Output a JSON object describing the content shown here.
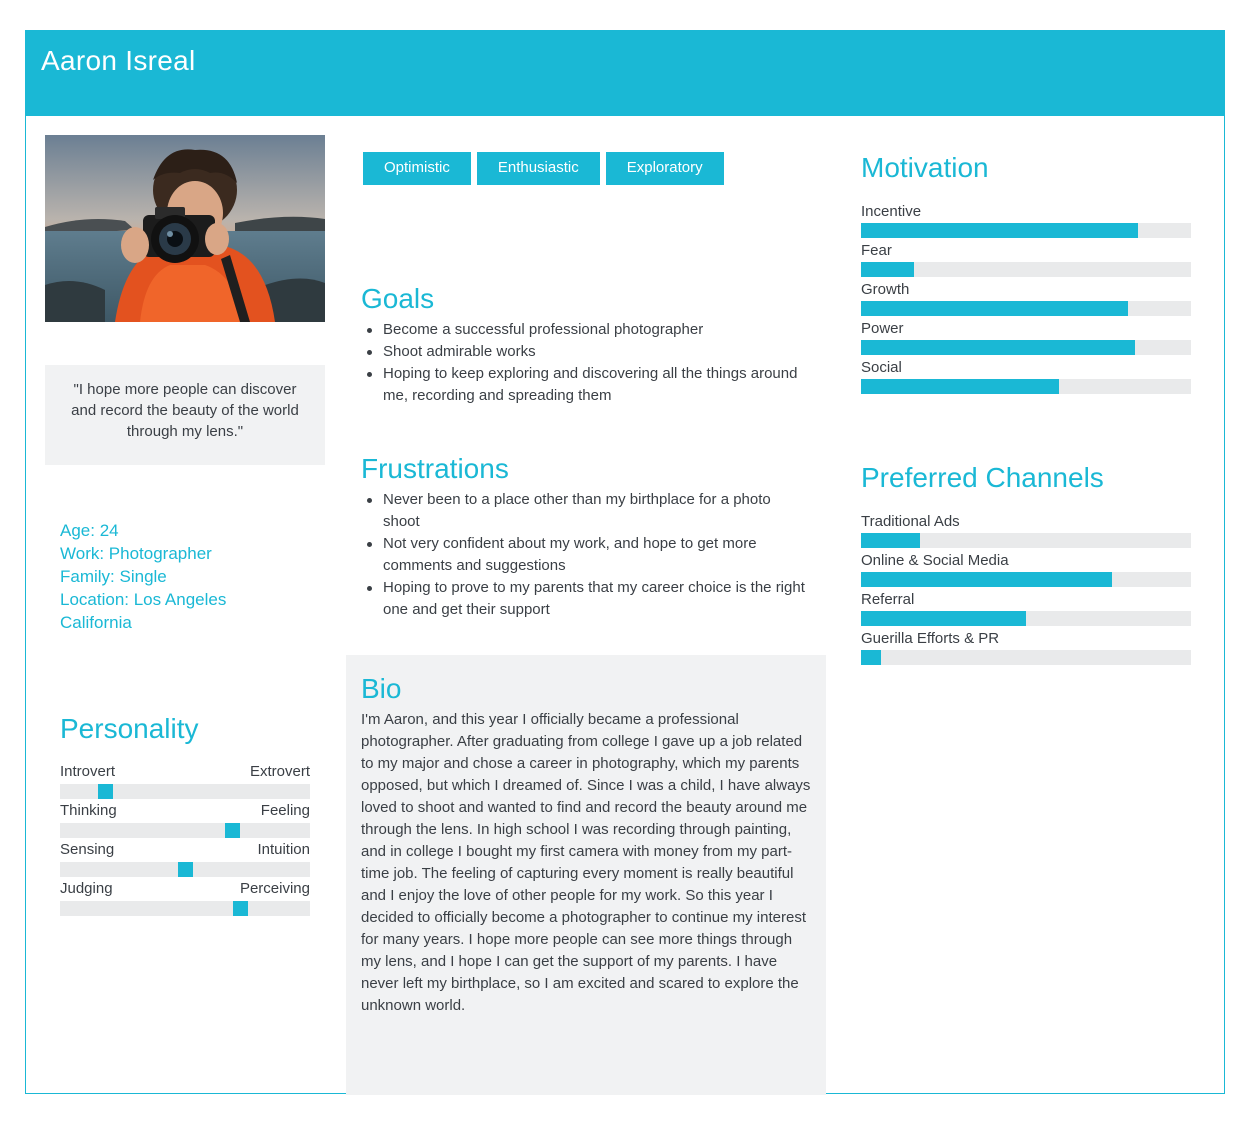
{
  "header": {
    "name": "Aaron Isreal"
  },
  "photo": {
    "description_icon": "photographer-portrait"
  },
  "quote": "\"I hope more people can discover and record the beauty of the world through my lens.\"",
  "demographics": {
    "age": "Age: 24",
    "work": "Work: Photographer",
    "family": "Family: Single",
    "location": "Location: Los Angeles⁣",
    "location_cont": "California"
  },
  "personality": {
    "title": "Personality",
    "traits": [
      {
        "left": "Introvert",
        "right": "Extrovert",
        "value": 0.18
      },
      {
        "left": "Thinking",
        "right": "Feeling",
        "value": 0.69
      },
      {
        "left": "Sensing",
        "right": "Intuition",
        "value": 0.5
      },
      {
        "left": "Judging",
        "right": "Perceiving",
        "value": 0.72
      }
    ]
  },
  "tags": [
    "Optimistic",
    "Enthusiastic",
    "Exploratory"
  ],
  "goals": {
    "title": "Goals",
    "items": [
      "Become a successful professional photographer",
      "Shoot admirable works",
      "Hoping to keep exploring and discovering all the things around me, recording and spreading them"
    ]
  },
  "frustrations": {
    "title": "Frustrations",
    "items": [
      "Never been to a place other than my birthplace for a photo shoot",
      "Not very confident about my work, and hope to get more comments and suggestions",
      " Hoping to prove to my parents that my career choice is the right one and get their support"
    ]
  },
  "bio": {
    "title": "Bio",
    "text": "I'm Aaron, and this year I officially became a professional photographer. After graduating from college I gave up a job related to my major and chose a career in photography, which my parents opposed, but which I dreamed of. Since I was a child, I have always loved to shoot and wanted to find and record the beauty around me through the lens. In high school I was recording through painting, and in college I bought my first camera with money from my part-time job. The feeling of capturing every moment is really beautiful and I enjoy the love of other people for my work. So this year I decided to officially become a photographer to continue my interest for many years. I hope more people can see more things through my lens, and I hope I can get the support of my parents. I have never left my birthplace, so I am excited and scared to explore the unknown world."
  },
  "motivation": {
    "title": "Motivation",
    "items": [
      {
        "label": "Incentive",
        "value": 0.84
      },
      {
        "label": "Fear",
        "value": 0.16
      },
      {
        "label": "Growth",
        "value": 0.81
      },
      {
        "label": "Power",
        "value": 0.83
      },
      {
        "label": "Social",
        "value": 0.6
      }
    ]
  },
  "channels": {
    "title": "Preferred Channels",
    "items": [
      {
        "label": "Traditional Ads",
        "value": 0.18
      },
      {
        "label": "Online & Social Media",
        "value": 0.76
      },
      {
        "label": "Referral",
        "value": 0.5
      },
      {
        "label": "Guerilla Efforts & PR",
        "value": 0.06
      }
    ]
  },
  "colors": {
    "accent": "#1ab8d5",
    "panel": "#f1f2f3",
    "track": "#e9eaeb"
  }
}
